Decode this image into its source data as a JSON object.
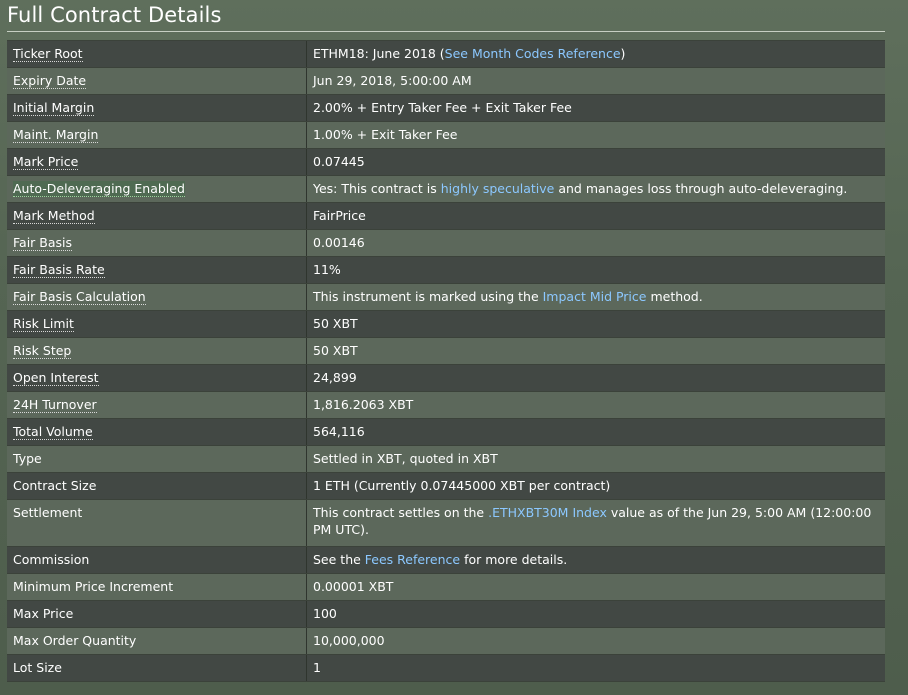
{
  "title": "Full Contract Details",
  "rows": [
    {
      "label": "Ticker Root",
      "pre": "ETHM18: June 2018 (",
      "link": "See Month Codes Reference",
      "post": ")"
    },
    {
      "label": "Expiry Date",
      "value": "Jun 29, 2018, 5:00:00 AM"
    },
    {
      "label": "Initial Margin",
      "value": "2.00% + Entry Taker Fee + Exit Taker Fee"
    },
    {
      "label": "Maint. Margin",
      "value": "1.00% + Exit Taker Fee"
    },
    {
      "label": "Mark Price",
      "value": "0.07445"
    },
    {
      "label": "Auto-Deleveraging Enabled",
      "pre": "Yes: This contract is ",
      "link": "highly speculative",
      "post": " and manages loss through auto-deleveraging."
    },
    {
      "label": "Mark Method",
      "value": "FairPrice"
    },
    {
      "label": "Fair Basis",
      "value": "0.00146"
    },
    {
      "label": "Fair Basis Rate",
      "value": "11%"
    },
    {
      "label": "Fair Basis Calculation",
      "pre": "This instrument is marked using the ",
      "link": "Impact Mid Price",
      "post": " method."
    },
    {
      "label": "Risk Limit",
      "value": "50 XBT"
    },
    {
      "label": "Risk Step",
      "value": "50 XBT"
    },
    {
      "label": "Open Interest",
      "value": "24,899"
    },
    {
      "label": "24H Turnover",
      "value": "1,816.2063 XBT"
    },
    {
      "label": "Total Volume",
      "value": "564,116"
    },
    {
      "label": "Type",
      "value": "Settled in XBT, quoted in XBT"
    },
    {
      "label": "Contract Size",
      "value": "1 ETH (Currently 0.07445000 XBT per contract)"
    },
    {
      "label": "Settlement",
      "pre": "This contract settles on the ",
      "link": ".ETHXBT30M Index",
      "post": " value as of the Jun 29, 5:00 AM (12:00:00 PM UTC)."
    },
    {
      "label": "Commission",
      "pre": "See the ",
      "link": "Fees Reference",
      "post": " for more details."
    },
    {
      "label": "Minimum Price Increment",
      "value": "0.00001 XBT"
    },
    {
      "label": "Max Price",
      "value": "100"
    },
    {
      "label": "Max Order Quantity",
      "value": "10,000,000"
    },
    {
      "label": "Lot Size",
      "value": "1"
    }
  ]
}
